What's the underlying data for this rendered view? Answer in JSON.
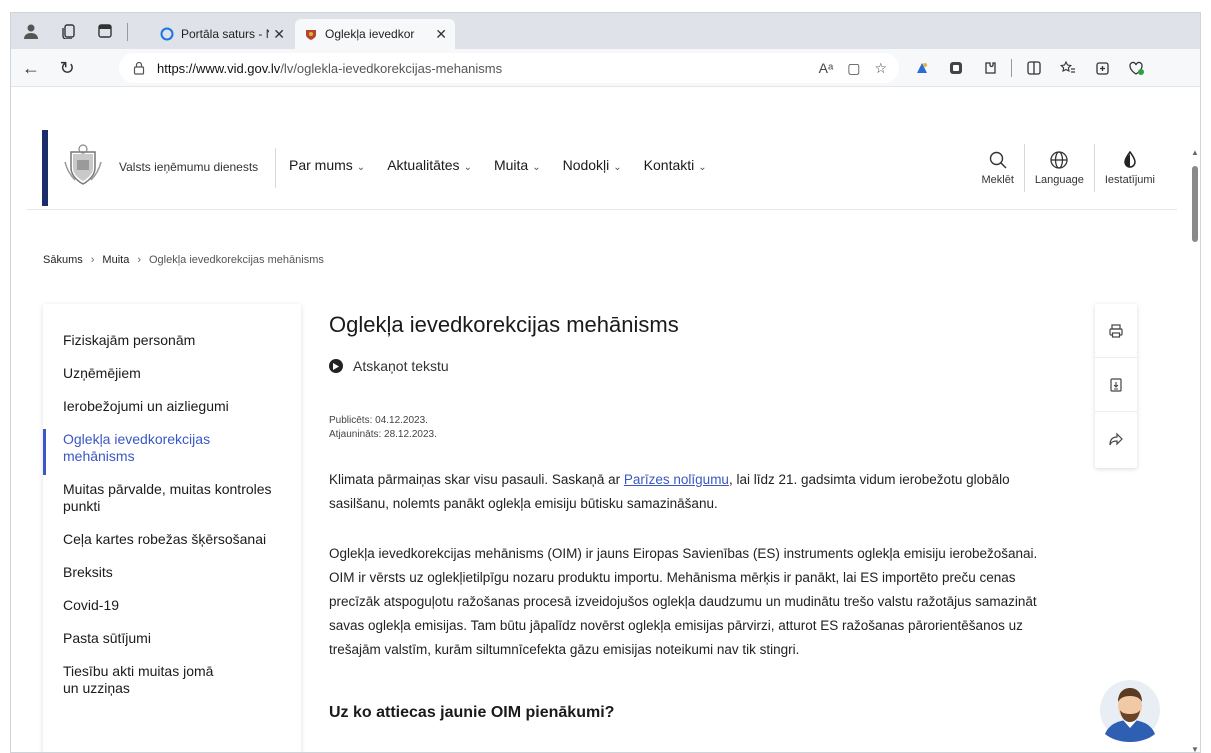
{
  "browser": {
    "tabs": [
      {
        "title": "Portāla saturs - N",
        "active": false
      },
      {
        "title": "Oglekļa ievedkor",
        "active": true
      }
    ],
    "url_host": "https://www.vid.gov.lv",
    "url_path": "/lv/oglekla-ievedkorekcijas-mehanisms",
    "reader_icon": "Aᵃ"
  },
  "site": {
    "brand": "Valsts ieņēmumu dienests",
    "nav": [
      "Par mums",
      "Aktualitātes",
      "Muita",
      "Nodokļi",
      "Kontakti"
    ],
    "tools": {
      "search": "Meklēt",
      "language": "Language",
      "settings": "Iestatījumi"
    },
    "brand_color": "#1b2d6b",
    "accent_color": "#3a57c4"
  },
  "breadcrumb": {
    "home": "Sākums",
    "section": "Muita",
    "current": "Oglekļa ievedkorekcijas mehānisms"
  },
  "sidebar": {
    "items": [
      {
        "label": "Fiziskajām personām"
      },
      {
        "label": "Uzņēmējiem"
      },
      {
        "label": "Ierobežojumi un aizliegumi"
      },
      {
        "label": "Oglekļa ievedkorekcijas mehānisms",
        "active": true
      },
      {
        "label": "Muitas pārvalde, muitas kontroles punkti"
      },
      {
        "label": "Ceļa kartes robežas šķērsošanai"
      },
      {
        "label": "Breksits"
      },
      {
        "label": "Covid-19"
      },
      {
        "label": "Pasta sūtījumi"
      },
      {
        "label": "Tiesību akti muitas jomā un uzziņas"
      }
    ]
  },
  "content": {
    "title": "Oglekļa ievedkorekcijas mehānisms",
    "listen": "Atskaņot tekstu",
    "published": "Publicēts: 04.12.2023.",
    "updated": "Atjaunināts: 28.12.2023.",
    "p1_before": "Klimata pārmaiņas skar visu pasauli. Saskaņā ar ",
    "p1_link": "Parīzes nolīgumu",
    "p1_after": ", lai līdz 21. gadsimta vidum ierobežotu globālo sasilšanu, nolemts panākt oglekļa emisiju būtisku samazināšanu.",
    "p2": "Oglekļa ievedkorekcijas mehānisms (OIM) ir jauns Eiropas Savienības (ES) instruments oglekļa emisiju ierobežošanai. OIM ir vērsts uz oglekļietilpīgu nozaru produktu importu. Mehānisma mērķis ir panākt, lai ES importēto preču cenas precīzāk atspoguļotu ražošanas procesā izveidojušos oglekļa daudzumu un mudinātu trešo valstu ražotājus samazināt savas oglekļa emisijas. Tam būtu jāpalīdz novērst oglekļa emisijas pārvirzi, atturot ES ražošanas pārorientēšanos uz trešajām valstīm, kurām siltumnīcefekta gāzu emisijas noteikumi nav tik stingri.",
    "subhead": "Uz ko attiecas jaunie OIM pienākumi?"
  }
}
